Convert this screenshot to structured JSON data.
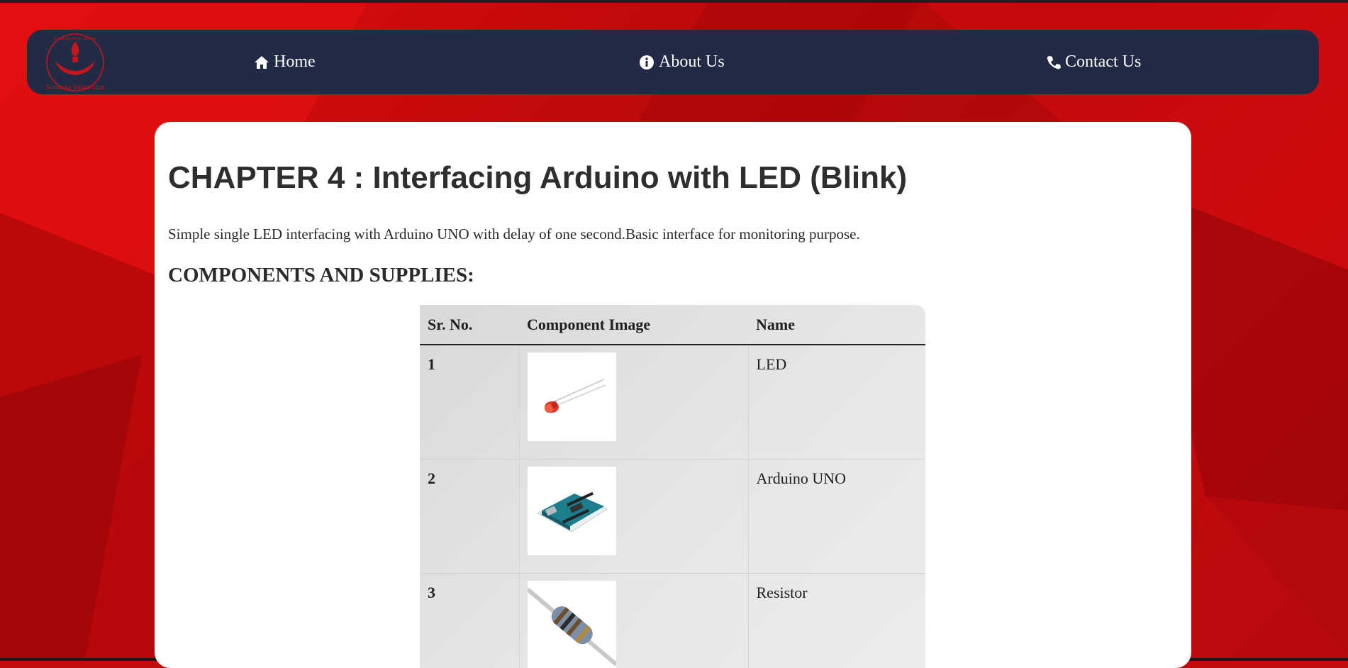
{
  "nav": {
    "logo_icon": "samaiya-vidyavihar-logo",
    "logo_text_top": "Knowledge Alone Liberates",
    "logo_text_bottom": "Somaiya Vidyavihar",
    "home": {
      "icon": "home-icon",
      "label": "Home"
    },
    "about": {
      "icon": "info-circle-icon",
      "label": "About Us"
    },
    "contact": {
      "icon": "phone-icon",
      "label": "Contact Us"
    }
  },
  "page": {
    "title": "CHAPTER 4 : Interfacing Arduino with LED (Blink)",
    "description": "Simple single LED interfacing with Arduino UNO with delay of one second.Basic interface for monitoring purpose.",
    "section_title": "COMPONENTS AND SUPPLIES:"
  },
  "components_table": {
    "headers": [
      "Sr. No.",
      "Component Image",
      "Name"
    ],
    "rows": [
      {
        "sr": "1",
        "image": "led-image",
        "name": "LED"
      },
      {
        "sr": "2",
        "image": "arduino-uno-image",
        "name": "Arduino UNO"
      },
      {
        "sr": "3",
        "image": "resistor-image",
        "name": "Resistor"
      }
    ]
  },
  "colors": {
    "background": "#c30a0e",
    "navbar": "#222a45",
    "card": "#ffffff",
    "logo": "#c4161c"
  }
}
